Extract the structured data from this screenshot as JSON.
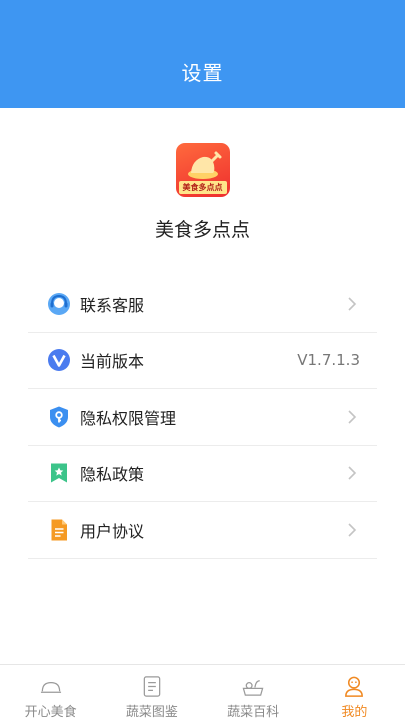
{
  "header": {
    "title": "设置"
  },
  "app": {
    "name": "美食多点点",
    "logo_text": "美食多点点"
  },
  "menu": [
    {
      "label": "联系客服",
      "icon": "customer-service-icon",
      "chevron": true
    },
    {
      "label": "当前版本",
      "icon": "version-icon",
      "value": "V1.7.1.3"
    },
    {
      "label": "隐私权限管理",
      "icon": "shield-key-icon",
      "chevron": true
    },
    {
      "label": "隐私政策",
      "icon": "bookmark-star-icon",
      "chevron": true
    },
    {
      "label": "用户协议",
      "icon": "document-icon",
      "chevron": true
    }
  ],
  "tabs": [
    {
      "label": "开心美食",
      "icon": "cloche-icon",
      "active": false
    },
    {
      "label": "蔬菜图鉴",
      "icon": "book-icon",
      "active": false
    },
    {
      "label": "蔬菜百科",
      "icon": "basket-icon",
      "active": false
    },
    {
      "label": "我的",
      "icon": "user-icon",
      "active": true
    }
  ],
  "colors": {
    "header_bg": "#3e96f2",
    "active_tab": "#f08a24",
    "inactive_tab": "#8a8a8a"
  }
}
